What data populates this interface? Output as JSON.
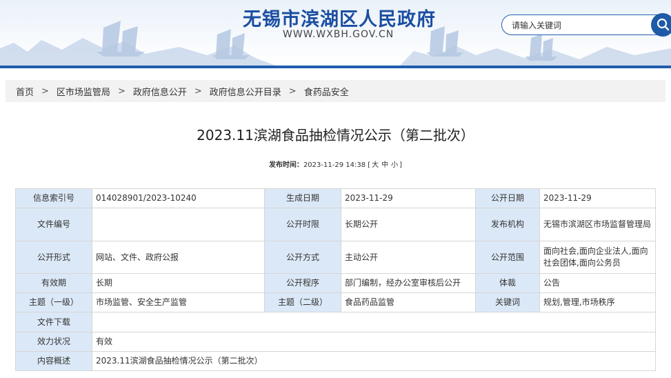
{
  "header": {
    "site_title": "无锡市滨湖区人民政府",
    "site_url": "WWW.WXBH.GOV.CN",
    "search_placeholder": "请输入关键词"
  },
  "breadcrumb": [
    "首页",
    "区市场监管局",
    "政府信息公开",
    "政府信息公开目录",
    "食药品安全"
  ],
  "article": {
    "title": "2023.11滨湖食品抽检情况公示（第二批次）",
    "pub_label": "发布时间：",
    "pub_time": "2023-11-29 14:38",
    "size_open": "[",
    "size_large": "大",
    "size_medium": "中",
    "size_small": "小",
    "size_close": "]"
  },
  "info_table": {
    "index_no_label": "信息索引号",
    "index_no": "014028901/2023-10240",
    "gen_date_label": "生成日期",
    "gen_date": "2023-11-29",
    "pub_date_label": "公开日期",
    "pub_date": "2023-11-29",
    "doc_no_label": "文件编号",
    "doc_no": "",
    "time_limit_label": "公开时限",
    "time_limit": "长期公开",
    "issuer_label": "发布机构",
    "issuer": "无锡市滨湖区市场监督管理局",
    "form_label": "公开形式",
    "form": "网站、文件、政府公报",
    "method_label": "公开方式",
    "method": "主动公开",
    "scope_label": "公开范围",
    "scope": "面向社会,面向企业法人,面向社会团体,面向公务员",
    "validity_label": "有效期",
    "validity": "长期",
    "procedure_label": "公开程序",
    "procedure": "部门编制，经办公室审核后公开",
    "genre_label": "体裁",
    "genre": "公告",
    "topic1_label": "主题（一级）",
    "topic1": "市场监管、安全生产监管",
    "topic2_label": "主题（二级）",
    "topic2": "食品药品监管",
    "keywords_label": "关键词",
    "keywords": "规划,管理,市场秩序",
    "download_label": "文件下载",
    "download": "",
    "status_label": "效力状况",
    "status": "有效",
    "summary_label": "内容概述",
    "summary": "2023.11滨湖食品抽检情况公示（第二批次）"
  },
  "colors": {
    "brand_blue": "#1f5dad",
    "table_key_bg": "#dbe8f7",
    "breadcrumb_bg": "#f2f2f2"
  },
  "icons": {
    "search": "search-icon"
  }
}
